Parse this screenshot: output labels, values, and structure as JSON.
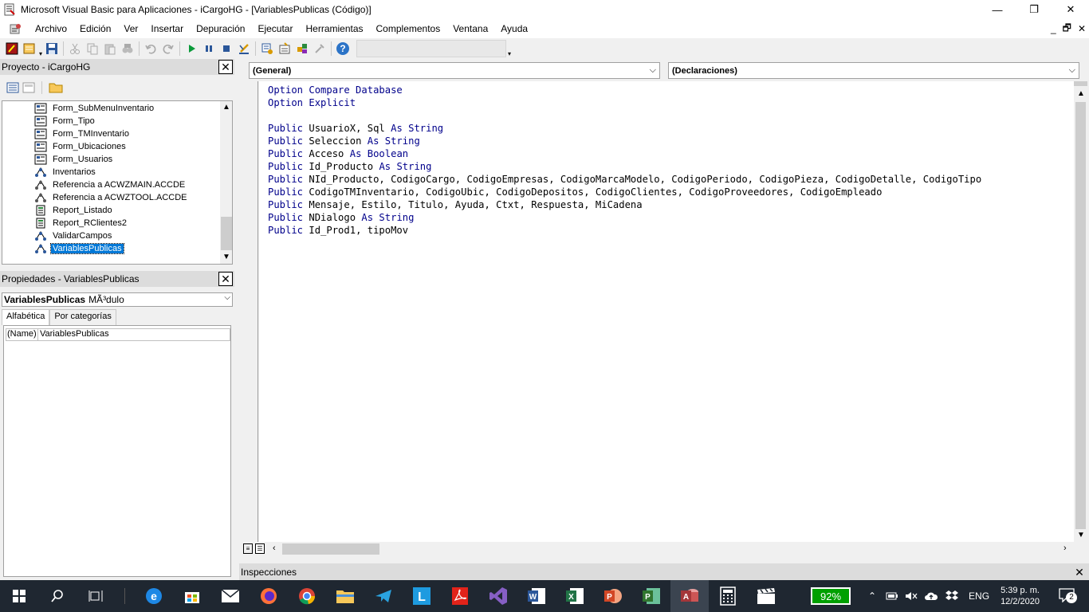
{
  "window": {
    "title": "Microsoft Visual Basic para Aplicaciones - iCargoHG - [VariablesPublicas (Código)]",
    "minimize": "—",
    "restore": "❐",
    "close": "✕"
  },
  "menu": {
    "items": [
      "Archivo",
      "Edición",
      "Ver",
      "Insertar",
      "Depuración",
      "Ejecutar",
      "Herramientas",
      "Complementos",
      "Ventana",
      "Ayuda"
    ],
    "mdi_min": "_",
    "mdi_restore": "🗗",
    "mdi_close": "✕"
  },
  "project": {
    "title": "Proyecto - iCargoHG",
    "items": [
      {
        "label": "Form_SubMenuInventario",
        "icon": "form-icon"
      },
      {
        "label": "Form_Tipo",
        "icon": "form-icon"
      },
      {
        "label": "Form_TMInventario",
        "icon": "form-icon"
      },
      {
        "label": "Form_Ubicaciones",
        "icon": "form-icon"
      },
      {
        "label": "Form_Usuarios",
        "icon": "form-icon"
      },
      {
        "label": "Inventarios",
        "icon": "module-icon"
      },
      {
        "label": "Referencia a ACWZMAIN.ACCDE",
        "icon": "reference-icon"
      },
      {
        "label": "Referencia a ACWZTOOL.ACCDE",
        "icon": "reference-icon"
      },
      {
        "label": "Report_Listado",
        "icon": "report-icon"
      },
      {
        "label": "Report_RClientes2",
        "icon": "report-icon"
      },
      {
        "label": "ValidarCampos",
        "icon": "module-icon"
      },
      {
        "label": "VariablesPublicas",
        "icon": "module-icon",
        "selected": true
      }
    ]
  },
  "properties": {
    "title": "Propiedades - VariablesPublicas",
    "object_name": "VariablesPublicas",
    "object_type": "MÃ³dulo",
    "tabs": [
      "Alfabética",
      "Por categorías"
    ],
    "rows": [
      {
        "name": "(Name)",
        "value": "VariablesPublicas"
      }
    ]
  },
  "code": {
    "object_combo": "(General)",
    "proc_combo": "(Declaraciones)",
    "lines": [
      [
        [
          "kw",
          "Option Compare Database"
        ]
      ],
      [
        [
          "kw",
          "Option Explicit"
        ]
      ],
      [],
      [
        [
          "kw",
          "Public"
        ],
        [
          "",
          "UsuarioX, Sql "
        ],
        [
          "kw",
          "As String"
        ]
      ],
      [
        [
          "kw",
          "Public"
        ],
        [
          "",
          "Seleccion "
        ],
        [
          "kw",
          "As String"
        ]
      ],
      [
        [
          "kw",
          "Public"
        ],
        [
          "",
          "Acceso "
        ],
        [
          "kw",
          "As Boolean"
        ]
      ],
      [
        [
          "kw",
          "Public"
        ],
        [
          "",
          "Id_Producto "
        ],
        [
          "kw",
          "As String"
        ]
      ],
      [
        [
          "kw",
          "Public"
        ],
        [
          "",
          "NId_Producto, CodigoCargo, CodigoEmpresas, CodigoMarcaModelo, CodigoPeriodo, CodigoPieza, CodigoDetalle, CodigoTipo"
        ]
      ],
      [
        [
          "kw",
          "Public"
        ],
        [
          "",
          "CodigoTMInventario, CodigoUbic, CodigoDepositos, CodigoClientes, CodigoProveedores, CodigoEmpleado"
        ]
      ],
      [
        [
          "kw",
          "Public"
        ],
        [
          "",
          "Mensaje, Estilo, Titulo, Ayuda, Ctxt, Respuesta, MiCadena"
        ]
      ],
      [
        [
          "kw",
          "Public"
        ],
        [
          "",
          "NDialogo "
        ],
        [
          "kw",
          "As String"
        ]
      ],
      [
        [
          "kw",
          "Public"
        ],
        [
          "",
          "Id_Prod1, tipoMov"
        ]
      ]
    ]
  },
  "inspecciones": {
    "title": "Inspecciones"
  },
  "taskbar": {
    "battery": "92%",
    "lang": "ENG",
    "time": "5:39 p. m.",
    "date": "12/2/2020",
    "notifications": "2"
  },
  "colors": {
    "keyword": "#00008b",
    "selection": "#0078d7",
    "taskbar": "#1f2731"
  }
}
